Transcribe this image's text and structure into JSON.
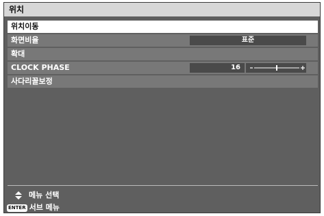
{
  "window": {
    "title": "위치"
  },
  "menu": {
    "items": [
      {
        "label": "위치이동",
        "selected": true
      },
      {
        "label": "화면비율",
        "value": "표준"
      },
      {
        "label": "확대"
      },
      {
        "label": "CLOCK PHASE",
        "value": "16",
        "slider_level": 0.5
      },
      {
        "label": "사다리꼴보정"
      }
    ]
  },
  "footer": {
    "nav_icon": "up-down-arrows-icon",
    "nav_label": "메뉴 선택",
    "enter_key": "ENTER",
    "enter_label": "서브 메뉴"
  },
  "colors": {
    "panel": "#5f5f5f",
    "row": "#787878",
    "selected": "#ffffff",
    "title": "#d7d7d7"
  }
}
